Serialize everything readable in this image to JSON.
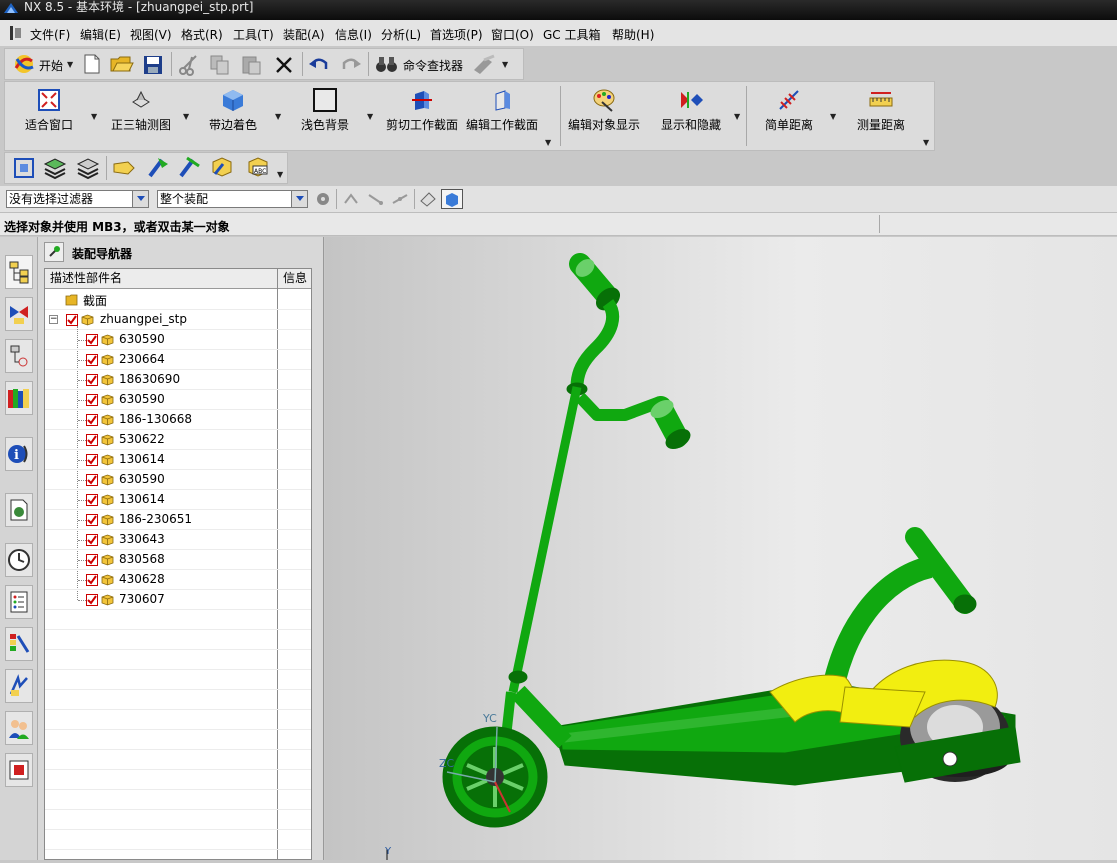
{
  "window": {
    "title": "NX 8.5 - 基本环境 - [zhuangpei_stp.prt]"
  },
  "menubar": {
    "items": [
      "文件(F)",
      "编辑(E)",
      "视图(V)",
      "格式(R)",
      "工具(T)",
      "装配(A)",
      "信息(I)",
      "分析(L)",
      "首选项(P)",
      "窗口(O)",
      "GC 工具箱",
      "帮助(H)"
    ]
  },
  "standard_toolbar": {
    "start_label": "开始",
    "command_finder_label": "命令查找器"
  },
  "view_toolbar": {
    "buttons": [
      "适合窗口",
      "正三轴测图",
      "带边着色",
      "浅色背景",
      "剪切工作截面",
      "编辑工作截面",
      "编辑对象显示",
      "显示和隐藏",
      "简单距离",
      "测量距离"
    ]
  },
  "filterbar": {
    "selection_filter": "没有选择过滤器",
    "scope": "整个装配"
  },
  "cue_line": {
    "text": "选择对象并使用 MB3，或者双击某一对象"
  },
  "assembly_navigator": {
    "title": "装配导航器",
    "columns": [
      "描述性部件名",
      "信息"
    ],
    "section_node": "截面",
    "root": "zhuangpei_stp",
    "components": [
      "630590",
      "230664",
      "18630690",
      "630590",
      "186-130668",
      "530622",
      "130614",
      "630590",
      "130614",
      "186-230651",
      "330643",
      "830568",
      "430628",
      "730607"
    ]
  },
  "viewport": {
    "triad_labels": {
      "y": "YC",
      "z": "ZC",
      "y_bottom": "Y"
    },
    "colors": {
      "part_green": "#10a810",
      "part_green_dark": "#077007",
      "part_yellow": "#f2ee10",
      "wheel_grey": "#9a9a9a"
    }
  },
  "icons": [
    "nx-app-icon",
    "start-icon",
    "new-file-icon",
    "open-folder-icon",
    "save-icon",
    "cut-icon",
    "copy-icon",
    "paste-icon",
    "delete-icon",
    "undo-icon",
    "redo-icon",
    "binoculars-icon",
    "fit-window-icon",
    "trimetric-icon",
    "shaded-cube-icon",
    "background-icon",
    "section-icon",
    "edit-section-icon",
    "edit-display-icon",
    "show-hide-icon",
    "simple-distance-icon",
    "measure-distance-icon"
  ]
}
